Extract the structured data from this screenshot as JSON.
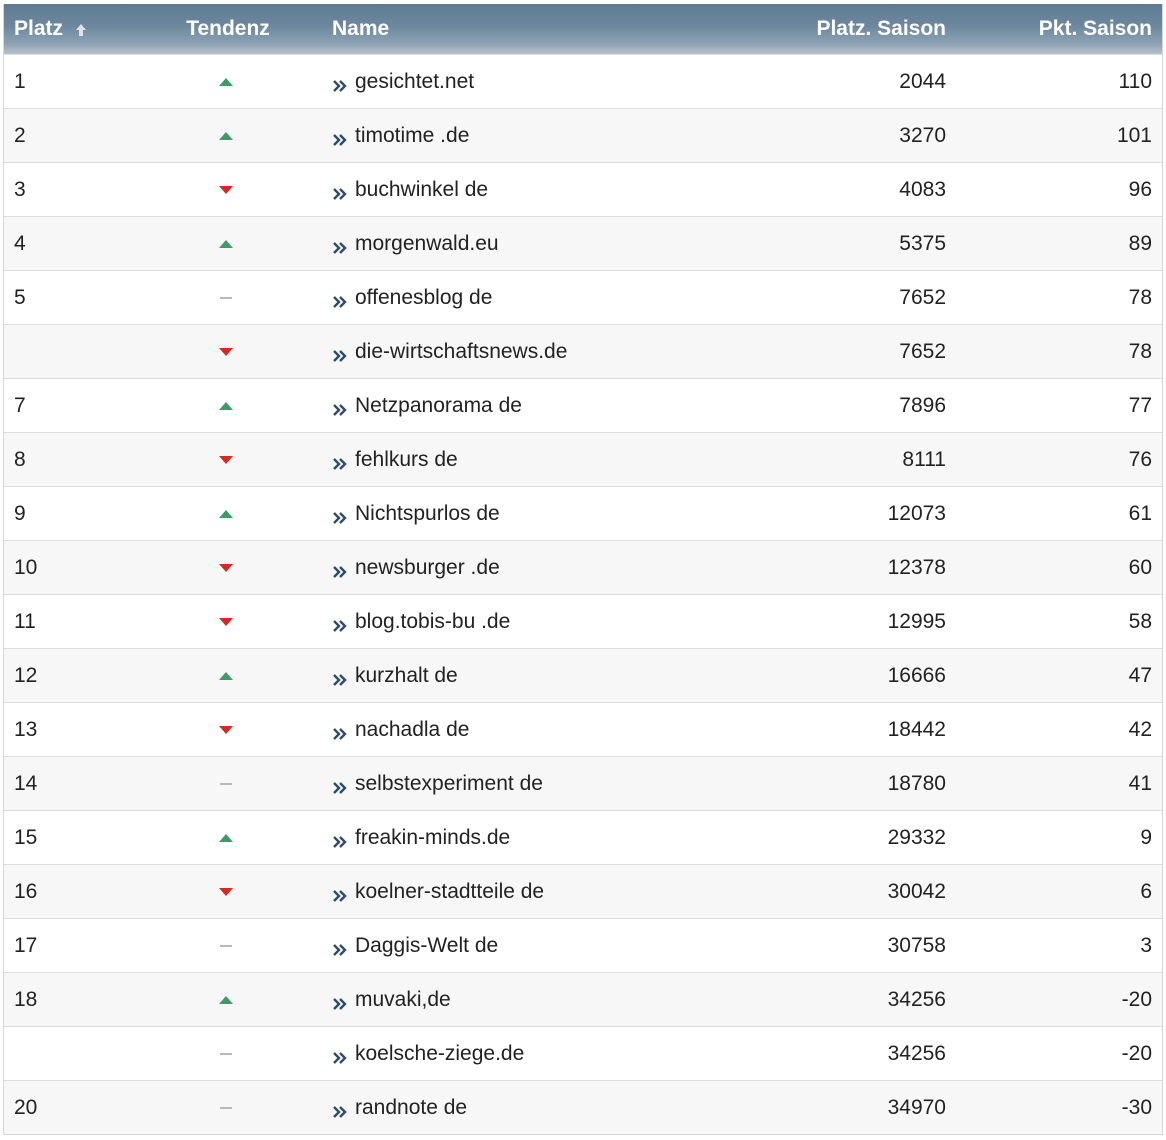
{
  "table": {
    "headers": {
      "platz": "Platz",
      "tendenz": "Tendenz",
      "name": "Name",
      "platz_saison": "Platz. Saison",
      "pkt_saison": "Pkt. Saison"
    },
    "colors": {
      "header_bg": "#6d889e",
      "trend_up": "#3e9a6b",
      "trend_down": "#d42a22",
      "trend_same": "#b9b9b9",
      "link_chevron": "#2f4a6b"
    },
    "rows": [
      {
        "platz": "1",
        "trend": "up",
        "name": "gesichtet.net",
        "platz_saison": "2044",
        "pkt_saison": "110"
      },
      {
        "platz": "2",
        "trend": "up",
        "name": "timotime .de",
        "platz_saison": "3270",
        "pkt_saison": "101"
      },
      {
        "platz": "3",
        "trend": "down",
        "name": "buchwinkel de",
        "platz_saison": "4083",
        "pkt_saison": "96"
      },
      {
        "platz": "4",
        "trend": "up",
        "name": "morgenwald.eu",
        "platz_saison": "5375",
        "pkt_saison": "89"
      },
      {
        "platz": "5",
        "trend": "same",
        "name": "offenesblog de",
        "platz_saison": "7652",
        "pkt_saison": "78"
      },
      {
        "platz": "",
        "trend": "down",
        "name": "die-wirtschaftsnews.de",
        "platz_saison": "7652",
        "pkt_saison": "78"
      },
      {
        "platz": "7",
        "trend": "up",
        "name": "Netzpanorama de",
        "platz_saison": "7896",
        "pkt_saison": "77"
      },
      {
        "platz": "8",
        "trend": "down",
        "name": "fehlkurs de",
        "platz_saison": "8111",
        "pkt_saison": "76"
      },
      {
        "platz": "9",
        "trend": "up",
        "name": "Nichtspurlos de",
        "platz_saison": "12073",
        "pkt_saison": "61"
      },
      {
        "platz": "10",
        "trend": "down",
        "name": "newsburger .de",
        "platz_saison": "12378",
        "pkt_saison": "60"
      },
      {
        "platz": "11",
        "trend": "down",
        "name": "blog.tobis-bu .de",
        "platz_saison": "12995",
        "pkt_saison": "58"
      },
      {
        "platz": "12",
        "trend": "up",
        "name": "kurzhalt de",
        "platz_saison": "16666",
        "pkt_saison": "47"
      },
      {
        "platz": "13",
        "trend": "down",
        "name": "nachadla de",
        "platz_saison": "18442",
        "pkt_saison": "42"
      },
      {
        "platz": "14",
        "trend": "same",
        "name": "selbstexperiment de",
        "platz_saison": "18780",
        "pkt_saison": "41"
      },
      {
        "platz": "15",
        "trend": "up",
        "name": "freakin-minds.de",
        "platz_saison": "29332",
        "pkt_saison": "9"
      },
      {
        "platz": "16",
        "trend": "down",
        "name": "koelner-stadtteile de",
        "platz_saison": "30042",
        "pkt_saison": "6"
      },
      {
        "platz": "17",
        "trend": "same",
        "name": "Daggis-Welt de",
        "platz_saison": "30758",
        "pkt_saison": "3"
      },
      {
        "platz": "18",
        "trend": "up",
        "name": "muvaki,de",
        "platz_saison": "34256",
        "pkt_saison": "-20"
      },
      {
        "platz": "",
        "trend": "same",
        "name": "koelsche-ziege.de",
        "platz_saison": "34256",
        "pkt_saison": "-20"
      },
      {
        "platz": "20",
        "trend": "same",
        "name": "randnote de",
        "platz_saison": "34970",
        "pkt_saison": "-30"
      }
    ]
  }
}
